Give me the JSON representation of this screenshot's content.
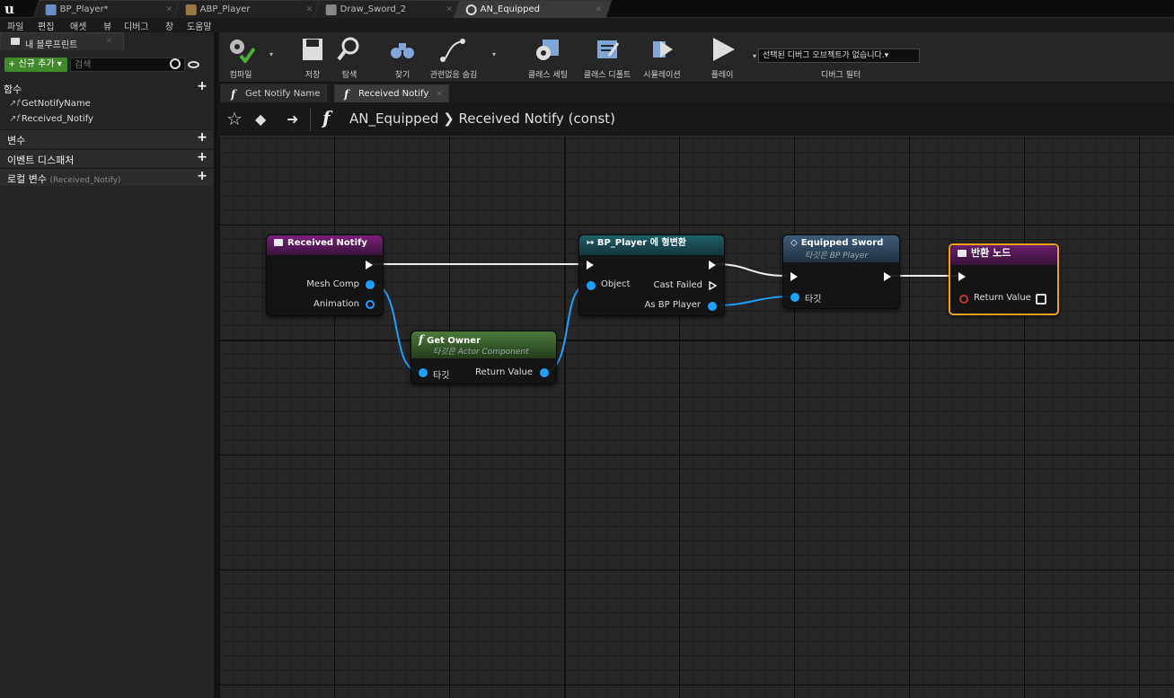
{
  "tabs": [
    {
      "label": "BP_Player*"
    },
    {
      "label": "ABP_Player"
    },
    {
      "label": "Draw_Sword_2"
    },
    {
      "label": "AN_Equipped"
    }
  ],
  "menu": [
    "파일",
    "편집",
    "애셋",
    "뷰",
    "디버그",
    "창",
    "도움말"
  ],
  "left_panel": {
    "header": "내 블루프린트",
    "add_new": "+ 신규 추가 ▾",
    "search_placeholder": "검색",
    "functions_label": "함수",
    "functions": [
      "GetNotifyName",
      "Received_Notify"
    ],
    "variables_label": "변수",
    "dispatchers_label": "이벤트 디스패처",
    "locals_label": "로컬 변수",
    "locals_scope": "(Received_Notify)"
  },
  "toolbar": {
    "compile": "컴파일",
    "save": "저장",
    "browse": "탐색",
    "find": "찾기",
    "hide_unrelated": "관련없음 숨김",
    "class_settings": "클래스 세팅",
    "class_defaults": "클래스 디폴트",
    "simulation": "시뮬레이션",
    "play": "플레이",
    "debug_select": "선택된 디버그 오브젝트가 없습니다.▾",
    "debug_filter": "디버그 필터"
  },
  "fn_tabs": [
    {
      "label": "Get Notify Name"
    },
    {
      "label": "Received Notify"
    }
  ],
  "breadcrumb": "AN_Equipped  ❯  Received Notify (const)",
  "nodes": {
    "received": {
      "title": "Received Notify",
      "mesh_comp": "Mesh Comp",
      "animation": "Animation"
    },
    "cast": {
      "title": "↦ BP_Player 에 형변환",
      "object": "Object",
      "cast_failed": "Cast Failed",
      "as_bp_player": "As BP Player"
    },
    "sword": {
      "title": "Equipped Sword",
      "subtitle": "타깃은 BP Player",
      "target": "타깃"
    },
    "ret": {
      "title": "반환 노드",
      "return_value": "Return Value"
    },
    "owner": {
      "title": "Get Owner",
      "subtitle": "타깃은 Actor Component",
      "target": "타깃",
      "return_value": "Return Value"
    }
  },
  "colors": {
    "event_header": "#7a1f7a",
    "cast_header": "#1f5f68",
    "var_header": "#3d5c78",
    "return_header": "#6a1f6a",
    "pure_header": "#4d7a3a",
    "object_pin": "#1ea0ff",
    "selected_outline": "#f0a020"
  }
}
